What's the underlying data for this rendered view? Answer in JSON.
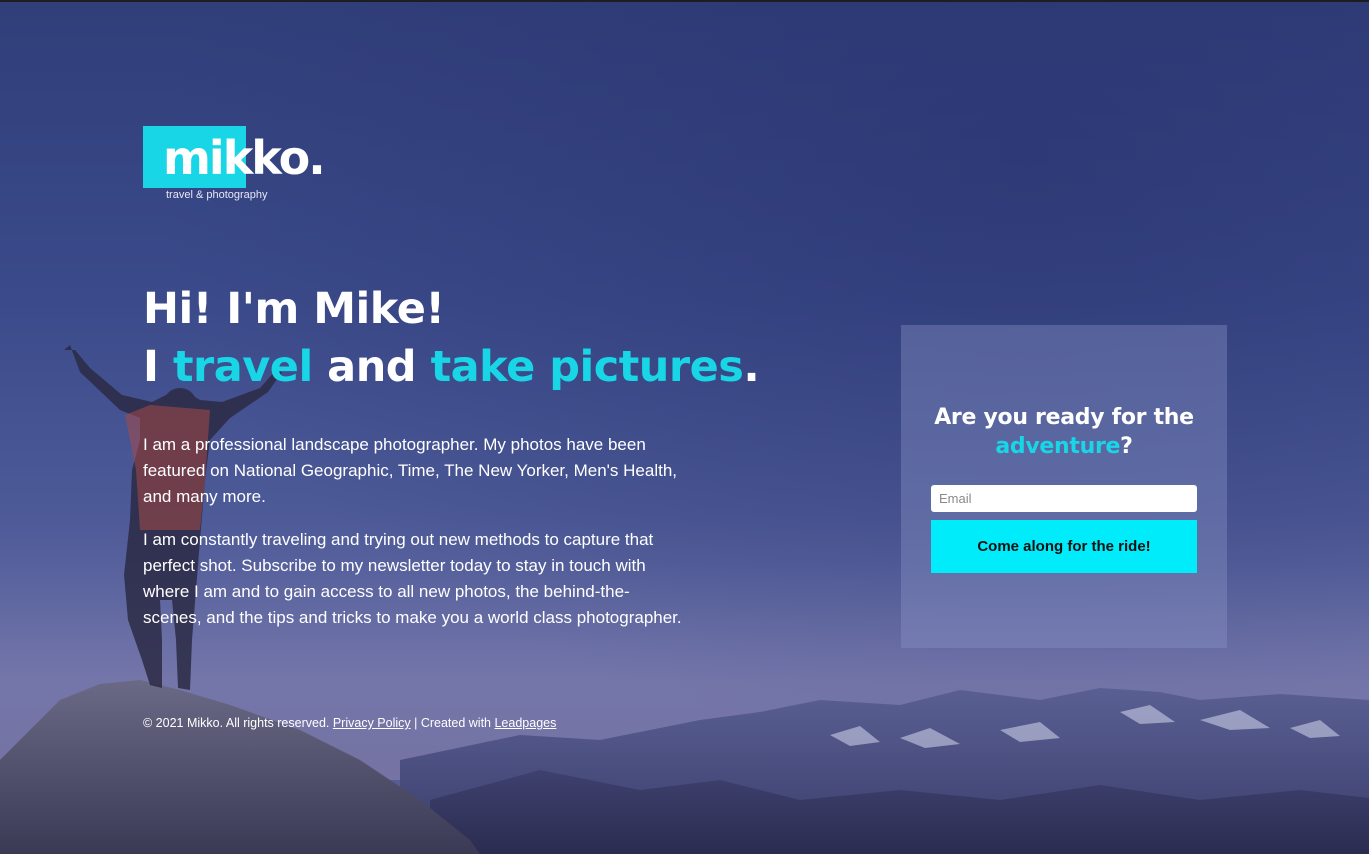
{
  "brand": {
    "logo_text": "mikko.",
    "tagline": "travel & photography",
    "accent_color": "#19d6e6",
    "button_color": "#00ecfb"
  },
  "hero": {
    "line1": "Hi! I'm Mike!",
    "line2_part1": "I ",
    "line2_accent1": "travel",
    "line2_part2": " and ",
    "line2_accent2": "take pictures",
    "line2_part3": "."
  },
  "bio": {
    "paragraph1": "I am a professional landscape photographer. My photos have been featured on National Geographic, Time, The New Yorker, Men's Health, and many more.",
    "paragraph2": "I am constantly traveling and trying out new methods to capture that perfect shot. Subscribe to my newsletter today to stay in touch with where I am and to gain access to all new photos, the behind-the-scenes, and the tips and tricks to make you a world class photographer."
  },
  "signup": {
    "title_part1": "Are you ready for the ",
    "title_accent": "adventure",
    "title_part2": "?",
    "email_placeholder": "Email",
    "email_value": "",
    "button_label": "Come along for the ride!"
  },
  "footer": {
    "copyright": "© 2021 Mikko. All rights reserved. ",
    "privacy_link": "Privacy Policy",
    "separator": " | Created with ",
    "leadpages_link": "Leadpages"
  }
}
